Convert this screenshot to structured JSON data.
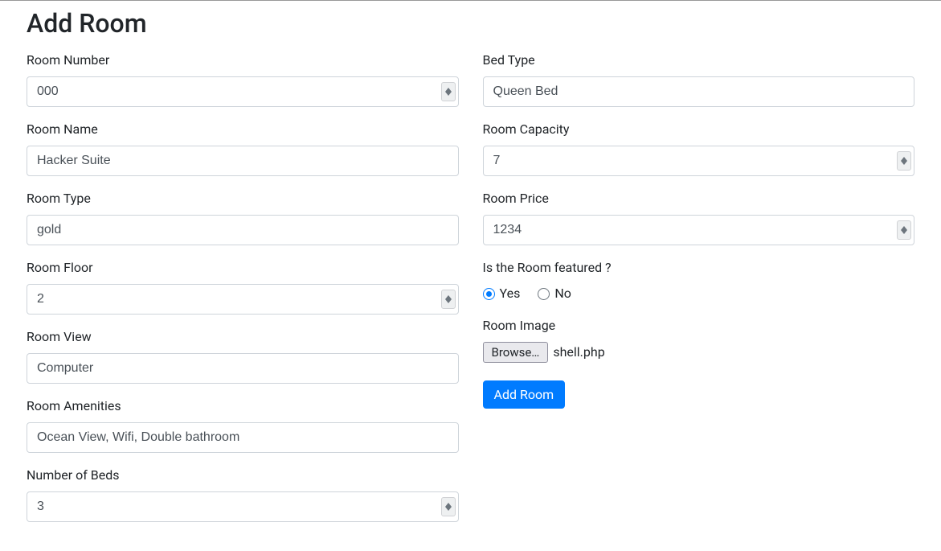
{
  "page": {
    "title": "Add Room"
  },
  "left": {
    "room_number": {
      "label": "Room Number",
      "value": "000"
    },
    "room_name": {
      "label": "Room Name",
      "value": "Hacker Suite"
    },
    "room_type": {
      "label": "Room Type",
      "value": "gold"
    },
    "room_floor": {
      "label": "Room Floor",
      "value": "2"
    },
    "room_view": {
      "label": "Room View",
      "value": "Computer"
    },
    "room_amenities": {
      "label": "Room Amenities",
      "value": "Ocean View, Wifi, Double bathroom"
    },
    "number_of_beds": {
      "label": "Number of Beds",
      "value": "3"
    }
  },
  "right": {
    "bed_type": {
      "label": "Bed Type",
      "value": "Queen Bed"
    },
    "room_capacity": {
      "label": "Room Capacity",
      "value": "7"
    },
    "room_price": {
      "label": "Room Price",
      "value": "1234"
    },
    "featured": {
      "label": "Is the Room featured ?",
      "yes": "Yes",
      "no": "No",
      "selected": "yes"
    },
    "room_image": {
      "label": "Room Image",
      "browse": "Browse…",
      "filename": "shell.php"
    },
    "submit": "Add Room"
  }
}
